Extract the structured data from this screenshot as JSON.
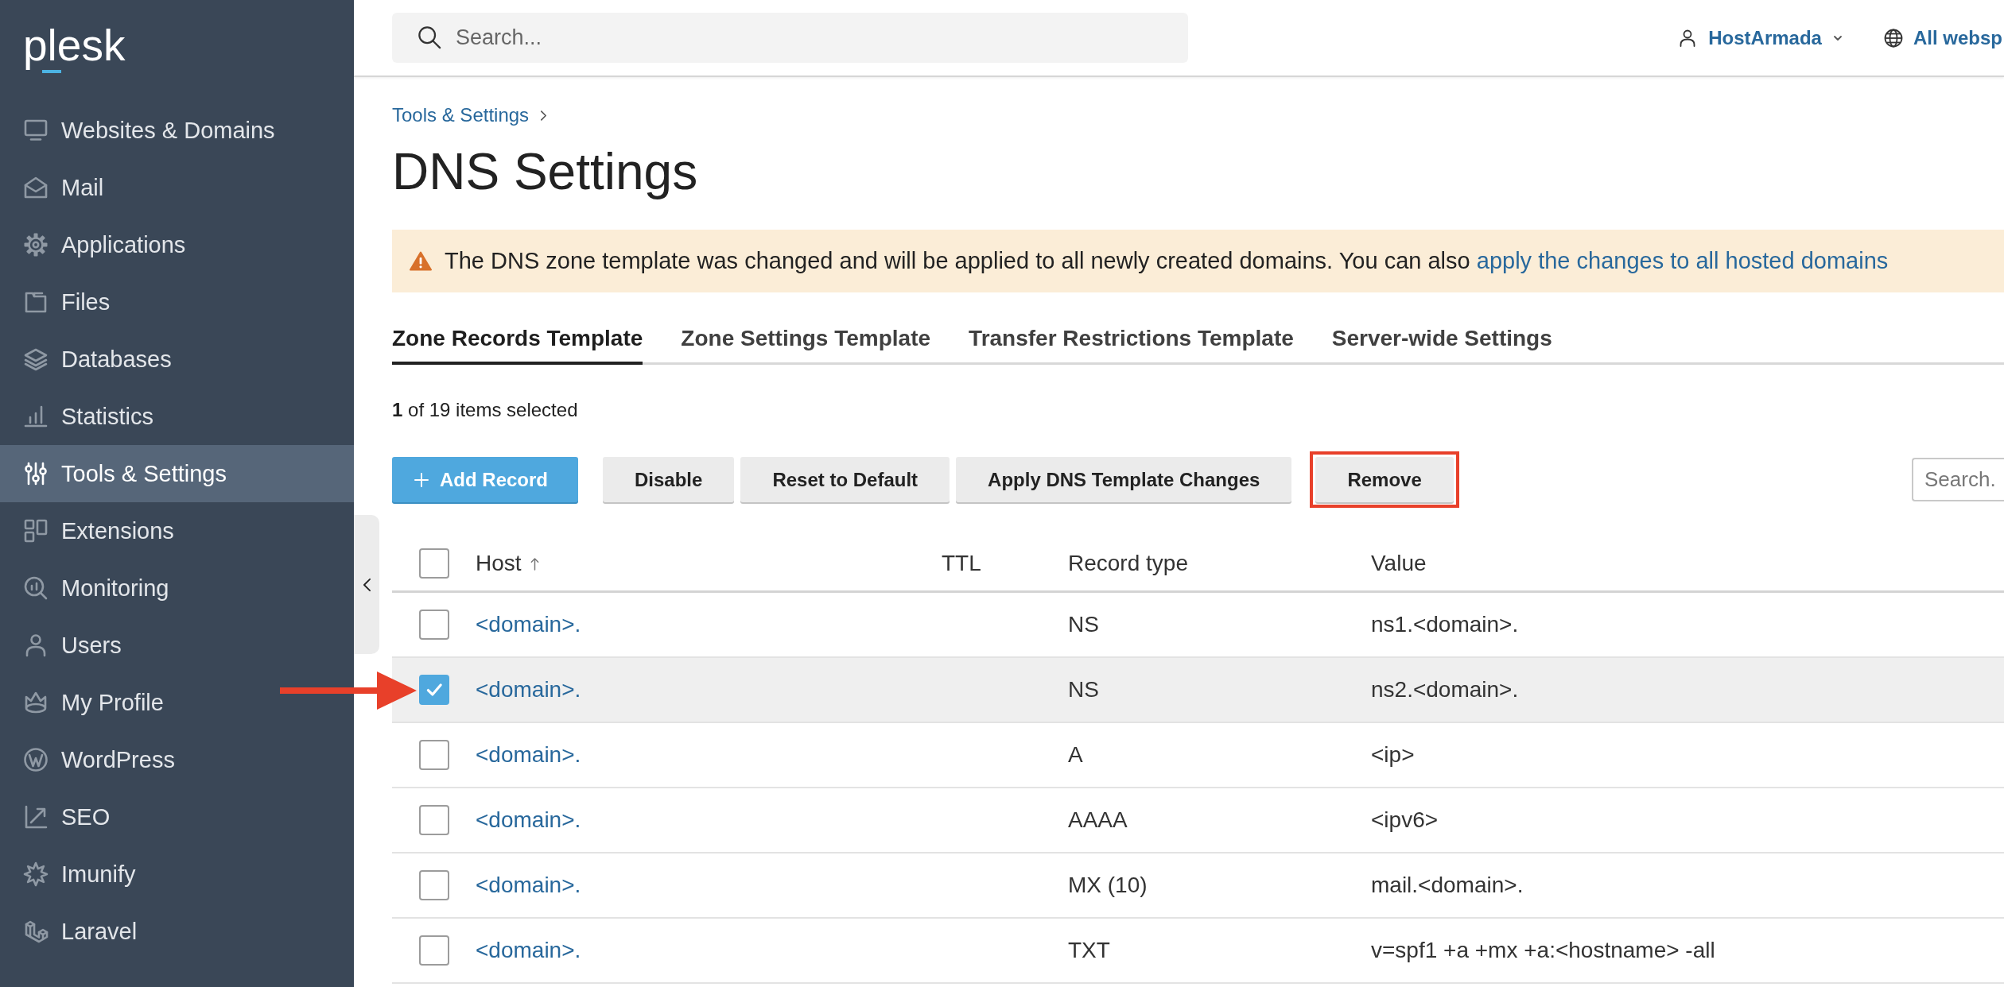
{
  "sidebar": {
    "logo": "plesk",
    "items": [
      {
        "label": "Websites & Domains",
        "selected": false
      },
      {
        "label": "Mail",
        "selected": false
      },
      {
        "label": "Applications",
        "selected": false
      },
      {
        "label": "Files",
        "selected": false
      },
      {
        "label": "Databases",
        "selected": false
      },
      {
        "label": "Statistics",
        "selected": false
      },
      {
        "label": "Tools & Settings",
        "selected": true
      },
      {
        "label": "Extensions",
        "selected": false
      },
      {
        "label": "Monitoring",
        "selected": false
      },
      {
        "label": "Users",
        "selected": false
      },
      {
        "label": "My Profile",
        "selected": false
      },
      {
        "label": "WordPress",
        "selected": false
      },
      {
        "label": "SEO",
        "selected": false
      },
      {
        "label": "Imunify",
        "selected": false
      },
      {
        "label": "Laravel",
        "selected": false
      }
    ]
  },
  "topbar": {
    "search": {
      "placeholder": "Search..."
    },
    "user_menu": {
      "label": "HostArmada"
    },
    "subscription_menu": {
      "label": "All websp"
    }
  },
  "breadcrumb": [
    {
      "label": "Tools & Settings"
    }
  ],
  "page_title": "DNS Settings",
  "alert": {
    "text": "The DNS zone template was changed and will be applied to all newly created domains. You can also",
    "link": "apply the changes to all hosted domains"
  },
  "tabs": [
    {
      "label": "Zone Records Template",
      "selected": true
    },
    {
      "label": "Zone Settings Template",
      "selected": false
    },
    {
      "label": "Transfer Restrictions Template",
      "selected": false
    },
    {
      "label": "Server-wide Settings",
      "selected": false
    }
  ],
  "selection_summary": "**1** of 19 items selected",
  "toolbar": {
    "buttons": [
      {
        "label": "Add Record",
        "kind": "primary",
        "highlighted": false
      },
      {
        "label": "Disable",
        "kind": "secondary",
        "highlighted": false
      },
      {
        "label": "Reset to Default",
        "kind": "secondary",
        "highlighted": false
      },
      {
        "label": "Apply DNS Template Changes",
        "kind": "secondary",
        "highlighted": false
      },
      {
        "label": "Remove",
        "kind": "secondary",
        "highlighted": true
      }
    ],
    "search": {
      "placeholder": "Search."
    }
  },
  "table": {
    "select_all": {
      "checked": false
    },
    "columns": [
      {
        "label": "Host",
        "sorted": true
      },
      {
        "label": "TTL",
        "sorted": false
      },
      {
        "label": "Record type",
        "sorted": false
      },
      {
        "label": "Value",
        "sorted": false
      }
    ],
    "rows": [
      {
        "host": "<domain>.",
        "record_type": "NS",
        "value": "ns1.<domain>.",
        "selected": false,
        "callout_arrow": false
      },
      {
        "host": "<domain>.",
        "record_type": "NS",
        "value": "ns2.<domain>.",
        "selected": true,
        "callout_arrow": true
      },
      {
        "host": "<domain>.",
        "record_type": "A",
        "value": "<ip>",
        "selected": false,
        "callout_arrow": false
      },
      {
        "host": "<domain>.",
        "record_type": "AAAA",
        "value": "<ipv6>",
        "selected": false,
        "callout_arrow": false
      },
      {
        "host": "<domain>.",
        "record_type": "MX (10)",
        "value": "mail.<domain>.",
        "selected": false,
        "callout_arrow": false
      },
      {
        "host": "<domain>.",
        "record_type": "TXT",
        "value": "v=spf1 +a +mx +a:<hostname> -all",
        "selected": false,
        "callout_arrow": false
      }
    ]
  }
}
